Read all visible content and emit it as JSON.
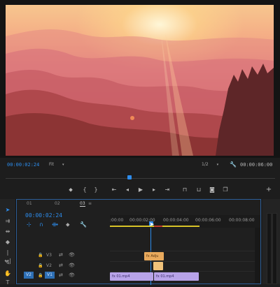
{
  "monitor": {
    "current_timecode": "00:00:02:24",
    "zoom": "Fit",
    "resolution": "1/2",
    "duration_timecode": "00:00:06:00"
  },
  "timeline": {
    "tabs": [
      "01",
      "02",
      "03"
    ],
    "active_tab": "03",
    "current_timecode": "00:00:02:24",
    "ruler_labels": [
      ":00:00",
      "00:00:02:00",
      "00:00:04:00",
      "00:00:06:00",
      "00:00:08:00"
    ],
    "tracks": [
      {
        "target": "",
        "label": "V3"
      },
      {
        "target": "",
        "label": "V2"
      },
      {
        "target": "V2",
        "label": "V1"
      }
    ],
    "clips": {
      "v3_clip": "Adju",
      "v1_clip_a": "01.mp4",
      "v1_clip_b": "01.mp4"
    }
  },
  "colors": {
    "accent_blue": "#2d8ceb",
    "clip_violet": "#b8a3e8",
    "clip_orange": "#e8a95c",
    "workarea_yellow": "#d8c328"
  }
}
